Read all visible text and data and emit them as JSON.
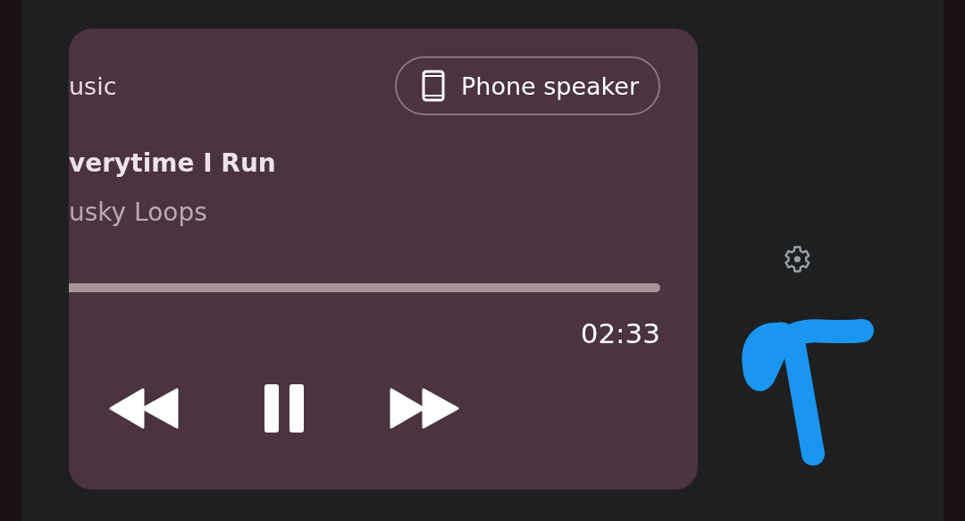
{
  "media_card": {
    "app_name": "usic",
    "output_chip": {
      "label": "Phone speaker"
    },
    "title": "verytime I Run",
    "artist": "usky Loops",
    "elapsed_time": "02:33",
    "playing": true
  }
}
